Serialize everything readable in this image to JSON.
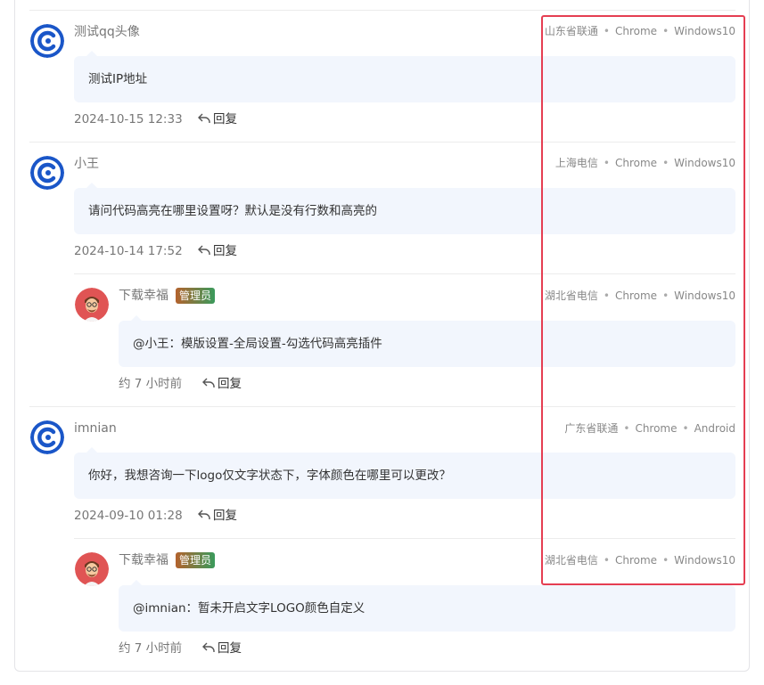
{
  "reply_label": "回复",
  "separator": "•",
  "comments": [
    {
      "name": "测试qq头像",
      "meta": [
        "山东省联通",
        "Chrome",
        "Windows10"
      ],
      "content": "测试IP地址",
      "time": "2024-10-15 12:33"
    },
    {
      "name": "小王",
      "meta": [
        "上海电信",
        "Chrome",
        "Windows10"
      ],
      "content": "请问代码高亮在哪里设置呀？默认是没有行数和高亮的",
      "time": "2024-10-14 17:52",
      "reply": {
        "name": "下载幸福",
        "badge": "管理员",
        "meta": [
          "湖北省电信",
          "Chrome",
          "Windows10"
        ],
        "content": "@小王：模版设置-全局设置-勾选代码高亮插件",
        "time": "约 7 小时前"
      }
    },
    {
      "name": "imnian",
      "meta": [
        "广东省联通",
        "Chrome",
        "Android"
      ],
      "content": "你好，我想咨询一下logo仅文字状态下，字体颜色在哪里可以更改？",
      "time": "2024-09-10 01:28",
      "reply": {
        "name": "下载幸福",
        "badge": "管理员",
        "meta": [
          "湖北省电信",
          "Chrome",
          "Windows10"
        ],
        "content": "@imnian：暂未开启文字LOGO颜色自定义",
        "time": "约 7 小时前"
      }
    }
  ],
  "colors": {
    "bubble_bg": "#f2f6fd",
    "highlight_border": "#e53e52",
    "avatar_blue": "#1a56c8",
    "avatar_red": "#e05454"
  }
}
